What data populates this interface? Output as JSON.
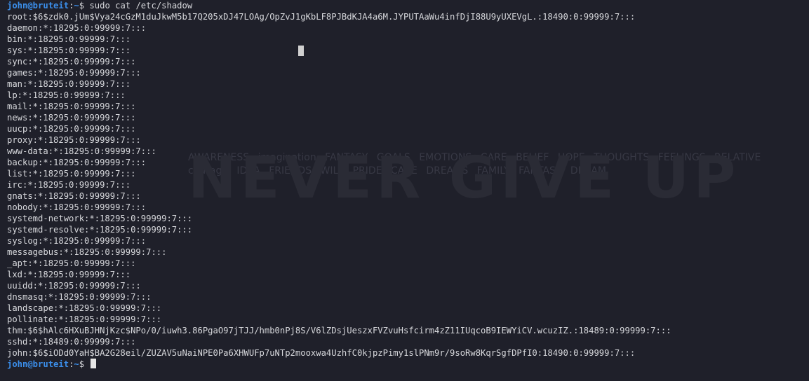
{
  "prompt": {
    "user_host": "john@bruteit",
    "separator": ":",
    "path": "~",
    "symbol": "$ "
  },
  "command": "sudo cat /etc/shadow",
  "output_lines": [
    "root:$6$zdk0.jUm$Vya24cGzM1duJkwM5b17Q205xDJ47LOAg/OpZvJ1gKbLF8PJBdKJA4a6M.JYPUTAaWu4infDjI88U9yUXEVgL.:18490:0:99999:7:::",
    "daemon:*:18295:0:99999:7:::",
    "bin:*:18295:0:99999:7:::",
    "sys:*:18295:0:99999:7:::",
    "sync:*:18295:0:99999:7:::",
    "games:*:18295:0:99999:7:::",
    "man:*:18295:0:99999:7:::",
    "lp:*:18295:0:99999:7:::",
    "mail:*:18295:0:99999:7:::",
    "news:*:18295:0:99999:7:::",
    "uucp:*:18295:0:99999:7:::",
    "proxy:*:18295:0:99999:7:::",
    "www-data:*:18295:0:99999:7:::",
    "backup:*:18295:0:99999:7:::",
    "list:*:18295:0:99999:7:::",
    "irc:*:18295:0:99999:7:::",
    "gnats:*:18295:0:99999:7:::",
    "nobody:*:18295:0:99999:7:::",
    "systemd-network:*:18295:0:99999:7:::",
    "systemd-resolve:*:18295:0:99999:7:::",
    "syslog:*:18295:0:99999:7:::",
    "messagebus:*:18295:0:99999:7:::",
    "_apt:*:18295:0:99999:7:::",
    "lxd:*:18295:0:99999:7:::",
    "uuidd:*:18295:0:99999:7:::",
    "dnsmasq:*:18295:0:99999:7:::",
    "landscape:*:18295:0:99999:7:::",
    "pollinate:*:18295:0:99999:7:::",
    "thm:$6$hAlc6HXuBJHNjKzc$NPo/0/iuwh3.86PgaO97jTJJ/hmb0nPj8S/V6lZDsjUeszxFVZvuHsfcirm4zZ11IUqcoB9IEWYiCV.wcuzIZ.:18489:0:99999:7:::",
    "sshd:*:18489:0:99999:7:::",
    "john:$6$iODd0YaH$BA2G28eil/ZUZAV5uNaiNPE0Pa6XHWUFp7uNTp2mooxwa4UzhfC0kjpzPimy1slPNm9r/9soRw8KqrSgfDPfI0:18490:0:99999:7:::"
  ],
  "wallpaper": {
    "headline": "NEVER GIVE UP",
    "words": "AWARENESS imagination FANTASY GOALS EMOTIONS CARE BELIEF HOPE THOUGHTS FEELINGS RELATIVE courage IDEA FRIENDS WILL PRIDE CARE DREAMS FAMILY FANTASY DREAM"
  },
  "colors": {
    "background": "#1f202a",
    "text": "#d7d8dc",
    "prompt": "#3b8eea"
  }
}
